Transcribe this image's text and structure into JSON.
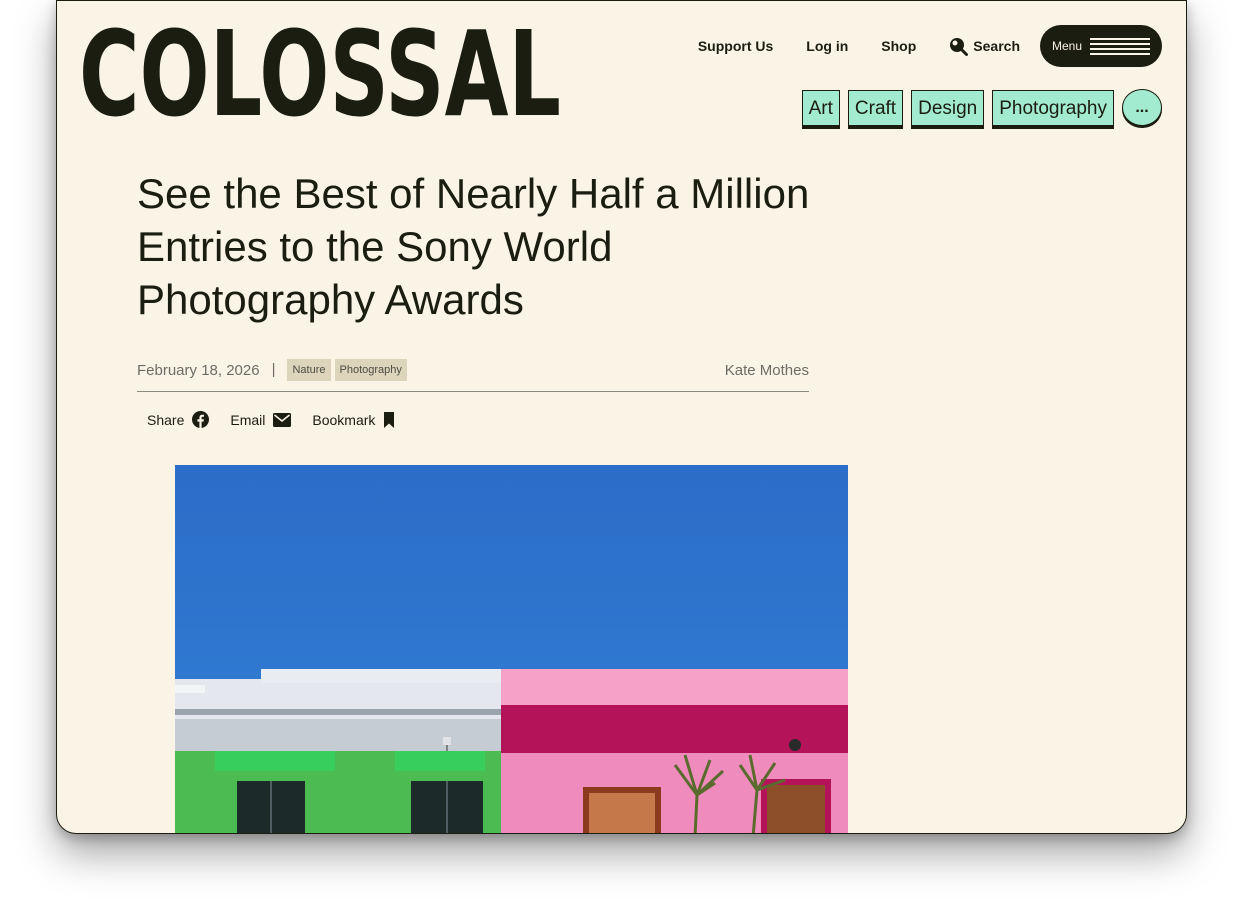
{
  "site": {
    "logo_text": "COLOSSAL"
  },
  "topnav": {
    "support": "Support Us",
    "login": "Log in",
    "shop": "Shop",
    "search": "Search",
    "menu": "Menu"
  },
  "categories": [
    "Art",
    "Craft",
    "Design",
    "Photography"
  ],
  "more_label": "...",
  "article": {
    "title": "See the Best of Nearly Half a Million Entries to the Sony World Photography Awards",
    "date": "February 18, 2026",
    "separator": "|",
    "tags": [
      "Nature",
      "Photography"
    ],
    "author": "Kate Mothes"
  },
  "actions": {
    "share": "Share",
    "email": "Email",
    "bookmark": "Bookmark"
  },
  "icons": {
    "search": "search-icon",
    "menu": "hamburger-icon",
    "share": "facebook-icon",
    "email": "envelope-icon",
    "bookmark": "bookmark-icon"
  },
  "colors": {
    "background": "#faf4e7",
    "ink": "#1b1d10",
    "category_bg": "#a3ebd0",
    "tag_bg": "#dcd4bb",
    "sky": "#2f77cf",
    "pink_building": "#f08bbd",
    "green_building": "#4fbf56"
  }
}
